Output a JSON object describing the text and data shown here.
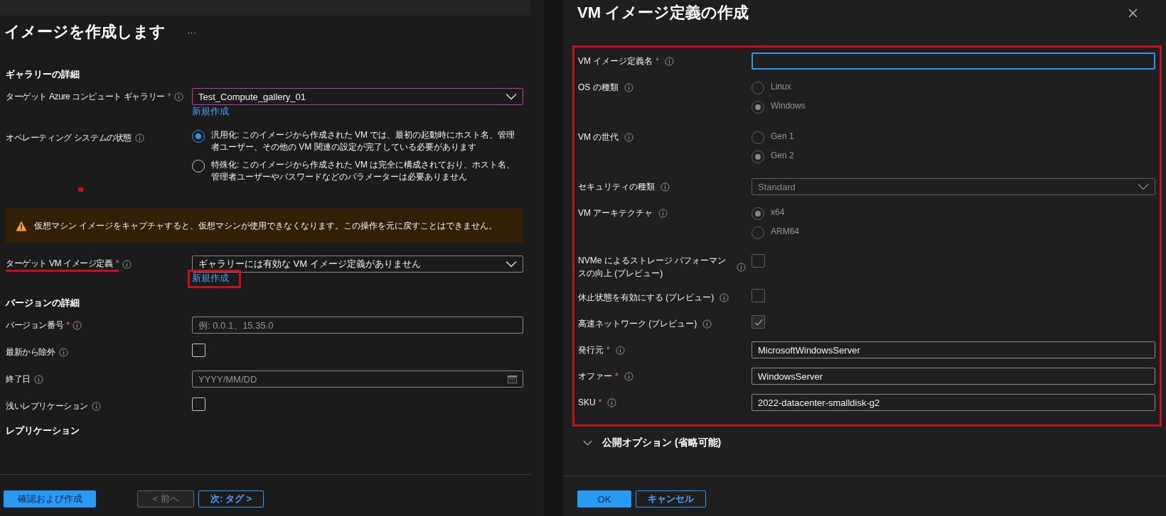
{
  "left": {
    "title": "イメージを作成します",
    "more": "···",
    "rows": [
      {
        "kind": "heading",
        "text": "ギャラリーの詳細"
      },
      {
        "kind": "dropdown",
        "label": "ターゲット Azure コンピュート ギャラリー",
        "required_mark": "*",
        "value": "Test_Compute_gallery_01",
        "focused": true,
        "link": "新規作成",
        "annotated": false
      },
      {
        "kind": "radio",
        "label": "オペレーティング システムの状態",
        "options": [
          {
            "text": "汎用化: このイメージから作成された VM では、最初の起動時にホスト名、管理者ユーザー、その他の VM 関連の設定が完了している必要があります",
            "selected": true
          },
          {
            "text": "特殊化: このイメージから作成された VM は完全に構成されており、ホスト名、管理者ユーザーやパスワードなどのパラメーターは必要ありません",
            "selected": false
          }
        ]
      },
      {
        "kind": "warning",
        "text": "仮想マシン イメージをキャプチャすると、仮想マシンが使用できなくなります。この操作を元に戻すことはできません。"
      },
      {
        "kind": "dropdown",
        "label": "ターゲット VM イメージ定義",
        "required_mark": "*",
        "value": "ギャラリーには有効な VM イメージ定義がありません",
        "focused": false,
        "link": "新規作成",
        "annotated": true
      },
      {
        "kind": "heading",
        "text": "バージョンの詳細"
      },
      {
        "kind": "text",
        "label": "バージョン番号",
        "required_mark": "*",
        "placeholder": "例: 0.0.1、15.35.0"
      },
      {
        "kind": "checkbox",
        "label": "最新から除外",
        "checked": false
      },
      {
        "kind": "date",
        "label": "終了日",
        "placeholder": "YYYY/MM/DD"
      },
      {
        "kind": "checkbox",
        "label": "浅いレプリケーション",
        "checked": false
      },
      {
        "kind": "heading",
        "text": "レプリケーション"
      }
    ],
    "buttons": [
      {
        "label": "確認および作成",
        "kind": "primary",
        "disabled": false
      },
      {
        "label": "< 前へ",
        "kind": "secondary",
        "disabled": true
      },
      {
        "label": "次: タグ >",
        "kind": "outline",
        "disabled": false
      }
    ]
  },
  "right": {
    "title": "VM イメージ定義の作成",
    "rows": [
      {
        "kind": "text",
        "label": "VM イメージ定義名",
        "required_mark": "*",
        "value": "",
        "focused": true
      },
      {
        "kind": "radio",
        "label": "OS の種類",
        "disabled": true,
        "options": [
          {
            "text": "Linux",
            "selected": false
          },
          {
            "text": "Windows",
            "selected": true
          }
        ]
      },
      {
        "kind": "radio",
        "label": "VM の世代",
        "disabled": true,
        "options": [
          {
            "text": "Gen 1",
            "selected": false
          },
          {
            "text": "Gen 2",
            "selected": true
          }
        ]
      },
      {
        "kind": "dropdown",
        "label": "セキュリティの種類",
        "value": "Standard",
        "disabled": true
      },
      {
        "kind": "radio",
        "label": "VM アーキテクチャ",
        "disabled": true,
        "options": [
          {
            "text": "x64",
            "selected": true
          },
          {
            "text": "ARM64",
            "selected": false
          }
        ]
      },
      {
        "kind": "checkbox",
        "label": "NVMe によるストレージ パフォーマンスの向上 (プレビュー)",
        "checked": false,
        "disabled": true
      },
      {
        "kind": "checkbox",
        "label": "休止状態を有効にする (プレビュー)",
        "checked": false,
        "disabled": true
      },
      {
        "kind": "checkbox",
        "label": "高速ネットワーク (プレビュー)",
        "checked": true,
        "disabled": true
      },
      {
        "kind": "text",
        "label": "発行元",
        "required_mark": "*",
        "value": "MicrosoftWindowsServer",
        "focused": false
      },
      {
        "kind": "text",
        "label": "オファー",
        "required_mark": "*",
        "value": "WindowsServer",
        "focused": false
      },
      {
        "kind": "text",
        "label": "SKU",
        "required_mark": "*",
        "value": "2022-datacenter-smalldisk-g2",
        "focused": false
      }
    ],
    "expander": {
      "label": "公開オプション (省略可能)",
      "expanded": false
    },
    "buttons": [
      {
        "label": "OK",
        "kind": "primary",
        "disabled": false
      },
      {
        "label": "キャンセル",
        "kind": "outline",
        "disabled": false
      }
    ]
  }
}
